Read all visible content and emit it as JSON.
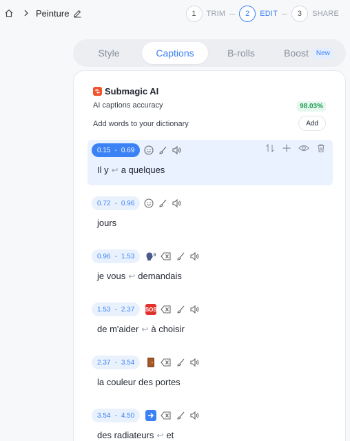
{
  "breadcrumb": {
    "title": "Peinture"
  },
  "steps": [
    {
      "num": "1",
      "label": "TRIM"
    },
    {
      "num": "2",
      "label": "EDIT"
    },
    {
      "num": "3",
      "label": "SHARE"
    }
  ],
  "tabs": {
    "style": "Style",
    "captions": "Captions",
    "brolls": "B-rolls",
    "boost": "Boost",
    "boost_badge": "New"
  },
  "panel": {
    "brand": "Submagic AI",
    "accuracy_label": "AI captions accuracy",
    "accuracy_value": "98.03%",
    "dictionary_label": "Add words to your dictionary",
    "add_button": "Add"
  },
  "captions": [
    {
      "start": "0.15",
      "end": "0.69",
      "words": [
        "Il y",
        "a quelques"
      ],
      "emoji": "smile"
    },
    {
      "start": "0.72",
      "end": "0.96",
      "words": [
        "jours"
      ],
      "emoji": "smile"
    },
    {
      "start": "0.96",
      "end": "1.53",
      "words": [
        "je vous",
        "demandais"
      ],
      "emoji": "speaking-head"
    },
    {
      "start": "1.53",
      "end": "2.37",
      "words": [
        "de m'aider",
        "à choisir"
      ],
      "emoji": "sos",
      "emoji_text": "SOS"
    },
    {
      "start": "2.37",
      "end": "3.54",
      "words": [
        "la couleur des portes"
      ],
      "emoji": "door"
    },
    {
      "start": "3.54",
      "end": "4.50",
      "words": [
        "des radiateurs",
        "et"
      ],
      "emoji": "right-arrow"
    }
  ],
  "colors": {
    "accent": "#3b82f6",
    "success": "#1f9d55",
    "brand": "#f0542d"
  }
}
